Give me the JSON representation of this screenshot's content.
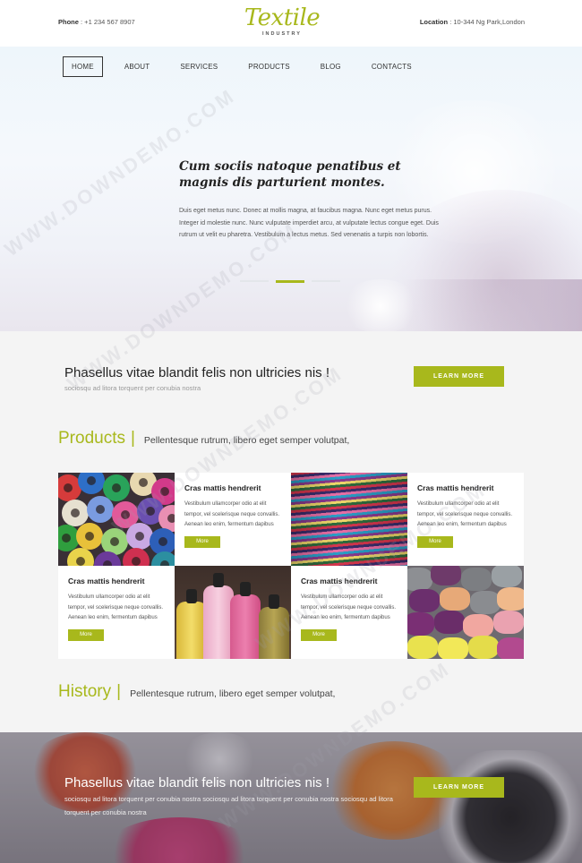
{
  "topbar": {
    "phone_label": "Phone",
    "phone_value": ": +1 234 567 8907",
    "location_label": "Location",
    "location_value": ": 10-344 Ng Park,London"
  },
  "logo": {
    "word": "Textile",
    "sub": "INDUSTRY"
  },
  "nav": {
    "items": [
      "HOME",
      "ABOUT",
      "SERVICES",
      "PRODUCTS",
      "BLOG",
      "CONTACTS"
    ],
    "active": "HOME"
  },
  "hero": {
    "title": "Cum sociis natoque penatibus et magnis dis parturient montes.",
    "text": "Duis eget metus nunc. Donec at mollis magna, at faucibus magna. Nunc eget metus purus. Integer id molestie nunc. Nunc vulputate imperdiet arcu, at vulputate lectus congue eget. Duis rutrum ut velit eu pharetra. Vestibulum a lectus metus. Sed venenatis a turpis non lobortis.",
    "slides": 3,
    "active_slide": 2
  },
  "cta1": {
    "title": "Phasellus vitae blandit felis non ultricies nis !",
    "sub": "sociosqu ad litora torquent per conubia nostra",
    "button": "LEARN MORE"
  },
  "products": {
    "heading": "Products",
    "tagline": "Pellentesque rutrum, libero eget semper volutpat,",
    "cards": [
      {
        "title": "Cras mattis hendrerit",
        "text": "Vestibulum ullamcorper odio at elit tempor, vel scelerisque neque convallis. Aenean leo enim, fermentum dapibus",
        "button": "More"
      },
      {
        "title": "Cras mattis hendrerit",
        "text": "Vestibulum ullamcorper odio at elit tempor, vel scelerisque neque convallis. Aenean leo enim, fermentum dapibus",
        "button": "More"
      },
      {
        "title": "Cras mattis hendrerit",
        "text": "Vestibulum ullamcorper odio at elit tempor, vel scelerisque neque convallis. Aenean leo enim, fermentum dapibus",
        "button": "More"
      },
      {
        "title": "Cras mattis hendrerit",
        "text": "Vestibulum ullamcorper odio at elit tempor, vel scelerisque neque convallis. Aenean leo enim, fermentum dapibus",
        "button": "More"
      }
    ]
  },
  "history": {
    "heading": "History",
    "tagline": "Pellentesque rutrum, libero eget semper volutpat,"
  },
  "cta2": {
    "title": "Phasellus vitae blandit felis non ultricies nis !",
    "sub": "sociosqu ad litora torquent per conubia nostra sociosqu ad litora torquent per conubia nostra sociosqu ad litora torquent per conubia nostra",
    "button": "LEARN MORE"
  },
  "watermark": "WWW.DOWNDEMO.COM",
  "colors": {
    "accent": "#a8b81c",
    "text": "#333333",
    "section_bg": "#f4f4f4"
  }
}
